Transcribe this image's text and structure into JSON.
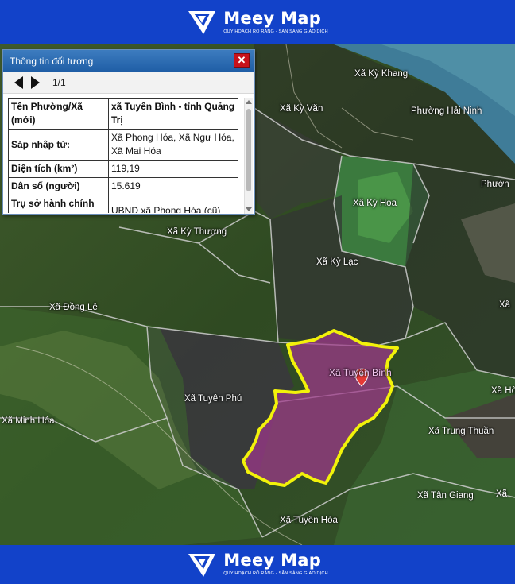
{
  "brand": {
    "name": "Meey Map",
    "tagline": "QUY HOẠCH RÕ RÀNG - SẴN SÀNG GIAO DỊCH"
  },
  "panel": {
    "title": "Thông tin đối tượng",
    "close": "✕",
    "pager": "1/1",
    "rows": [
      {
        "key": "Tên Phường/Xã (mới)",
        "value": "xã Tuyên Bình - tỉnh Quảng Trị"
      },
      {
        "key": "Sáp nhập từ:",
        "value": "Xã Phong Hóa, Xã Ngư Hóa, Xã Mai Hóa"
      },
      {
        "key": "Diện tích (km²)",
        "value": "119,19"
      },
      {
        "key": "Dân số (người)",
        "value": "15.619"
      },
      {
        "key": "Trụ sở hành chính (mới)",
        "value": "UBND xã Phong Hóa (cũ)"
      }
    ]
  },
  "map": {
    "labels": {
      "ky_khang": "Xã Kỳ Khang",
      "ky_van": "Xã Kỳ Văn",
      "hai_ninh": "Phường Hải Ninh",
      "phuong_right": "Phườn",
      "ky_hoa": "Xã Kỳ Hoa",
      "ky_thuong": "Xã Kỳ Thượng",
      "ky_lac": "Xã Kỳ Lạc",
      "dong_le": "Xã Đồng Lê",
      "xa_right": "Xã",
      "tuyen_binh": "Xã Tuyên Bình",
      "tuyen_phu": "Xã Tuyên Phú",
      "xa_ho": "Xã Hò",
      "minh_hoa": "Xã Minh Hóa",
      "trung_thuan": "Xã Trung Thuần",
      "tan_giang": "Xã Tân Giang",
      "xa_right2": "Xã",
      "tuyen_hoa": "Xã Tuyên Hóa"
    }
  }
}
